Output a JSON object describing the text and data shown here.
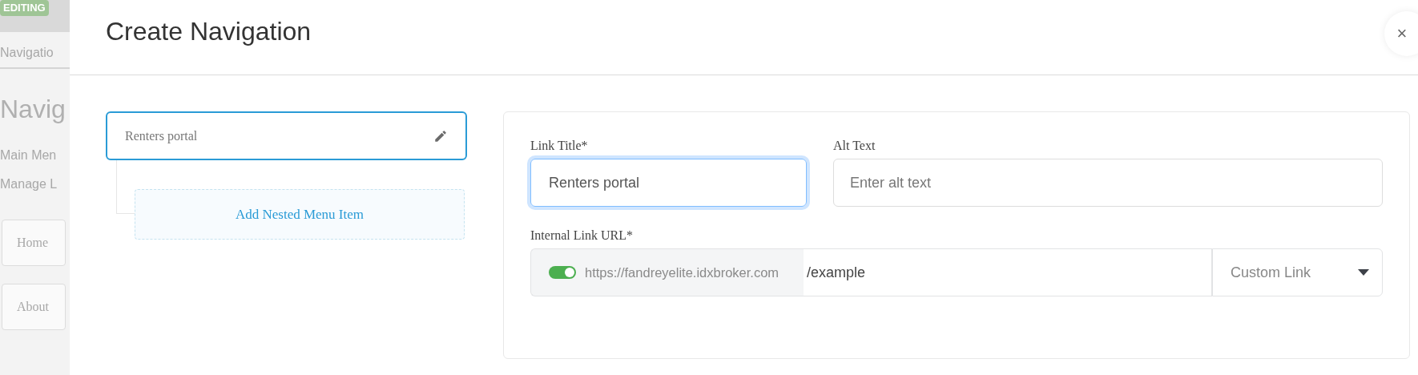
{
  "background_page": {
    "badge": "EDITING",
    "tab": "Navigatio",
    "heading": "Navig",
    "links": [
      "Main Men",
      "Manage L"
    ],
    "menu_cards": [
      "Home",
      "About"
    ]
  },
  "drawer": {
    "title": "Create Navigation",
    "close": "×",
    "menu_items": [
      {
        "label": "Renters portal",
        "selected": true
      }
    ],
    "add_nested": "Add Nested Menu Item",
    "form": {
      "link_title": {
        "label": "Link Title*",
        "value": "Renters portal",
        "focused": true
      },
      "alt_text": {
        "label": "Alt Text",
        "placeholder": "Enter alt text"
      },
      "url": {
        "label": "Internal Link URL*",
        "toggle_on": true,
        "domain": "https://fandreyelite.idxbroker.com",
        "path": "/example",
        "link_type": "Custom Link"
      }
    }
  }
}
